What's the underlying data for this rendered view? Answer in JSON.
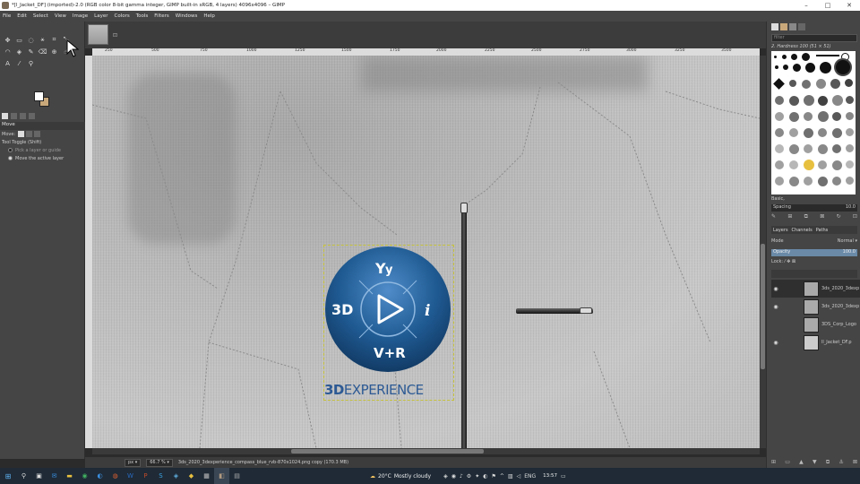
{
  "window": {
    "title": "*[l_Jacket_DF] (imported)-2.0 (RGB color 8-bit gamma integer, GIMP built-in sRGB, 4 layers) 4096x4096 – GIMP",
    "min": "–",
    "max": "□",
    "close": "✕"
  },
  "menu": [
    "File",
    "Edit",
    "Select",
    "View",
    "Image",
    "Layer",
    "Colors",
    "Tools",
    "Filters",
    "Windows",
    "Help"
  ],
  "tool_options": {
    "title": "Move",
    "move_label": "Move:",
    "tool_toggle": "Tool Toggle (Shift)",
    "opt1": "Pick a layer or guide",
    "opt2": "Move the active layer"
  },
  "ruler_top": [
    "250",
    "500",
    "750",
    "1000",
    "1250",
    "1500",
    "1750",
    "2000",
    "2250",
    "2500",
    "2750",
    "3000",
    "3250",
    "3500"
  ],
  "logo": {
    "badge_3d": "3D",
    "badge_i": "i",
    "badge_vr": "V+R",
    "wordmark_bold": "3D",
    "wordmark": "EXPERIENCE"
  },
  "status": {
    "unit": "px",
    "zoom": "66.7 %",
    "message": "3ds_2020_3dexperience_compass_blue_rvb-870x1024.png copy (170.3 MB)"
  },
  "brushes": {
    "filter_placeholder": "filter",
    "current": "2. Hardness 100 (51 × 51)",
    "preset": "Basic,",
    "spacing_label": "Spacing",
    "spacing_value": "10.0"
  },
  "layers": {
    "tab_layers": "Layers",
    "tab_channels": "Channels",
    "tab_paths": "Paths",
    "mode_label": "Mode",
    "mode_value": "Normal",
    "opacity_label": "Opacity",
    "opacity_value": "100.0",
    "lock_label": "Lock:",
    "items": [
      {
        "name": "3ds_2020_3dexp",
        "visible": true
      },
      {
        "name": "3ds_2020_3dexp",
        "visible": true
      },
      {
        "name": "3DS_Corp_Logo",
        "visible": false
      },
      {
        "name": "ll_Jacket_DF.p",
        "visible": true
      }
    ]
  },
  "taskbar": {
    "temperature": "20°C",
    "weather": "Mostly cloudy",
    "language": "ENG",
    "time": "13:57"
  },
  "colors": {
    "logo_blue": "#2d5a94",
    "fg": "#ffffff",
    "bg": "#c8a87a"
  }
}
